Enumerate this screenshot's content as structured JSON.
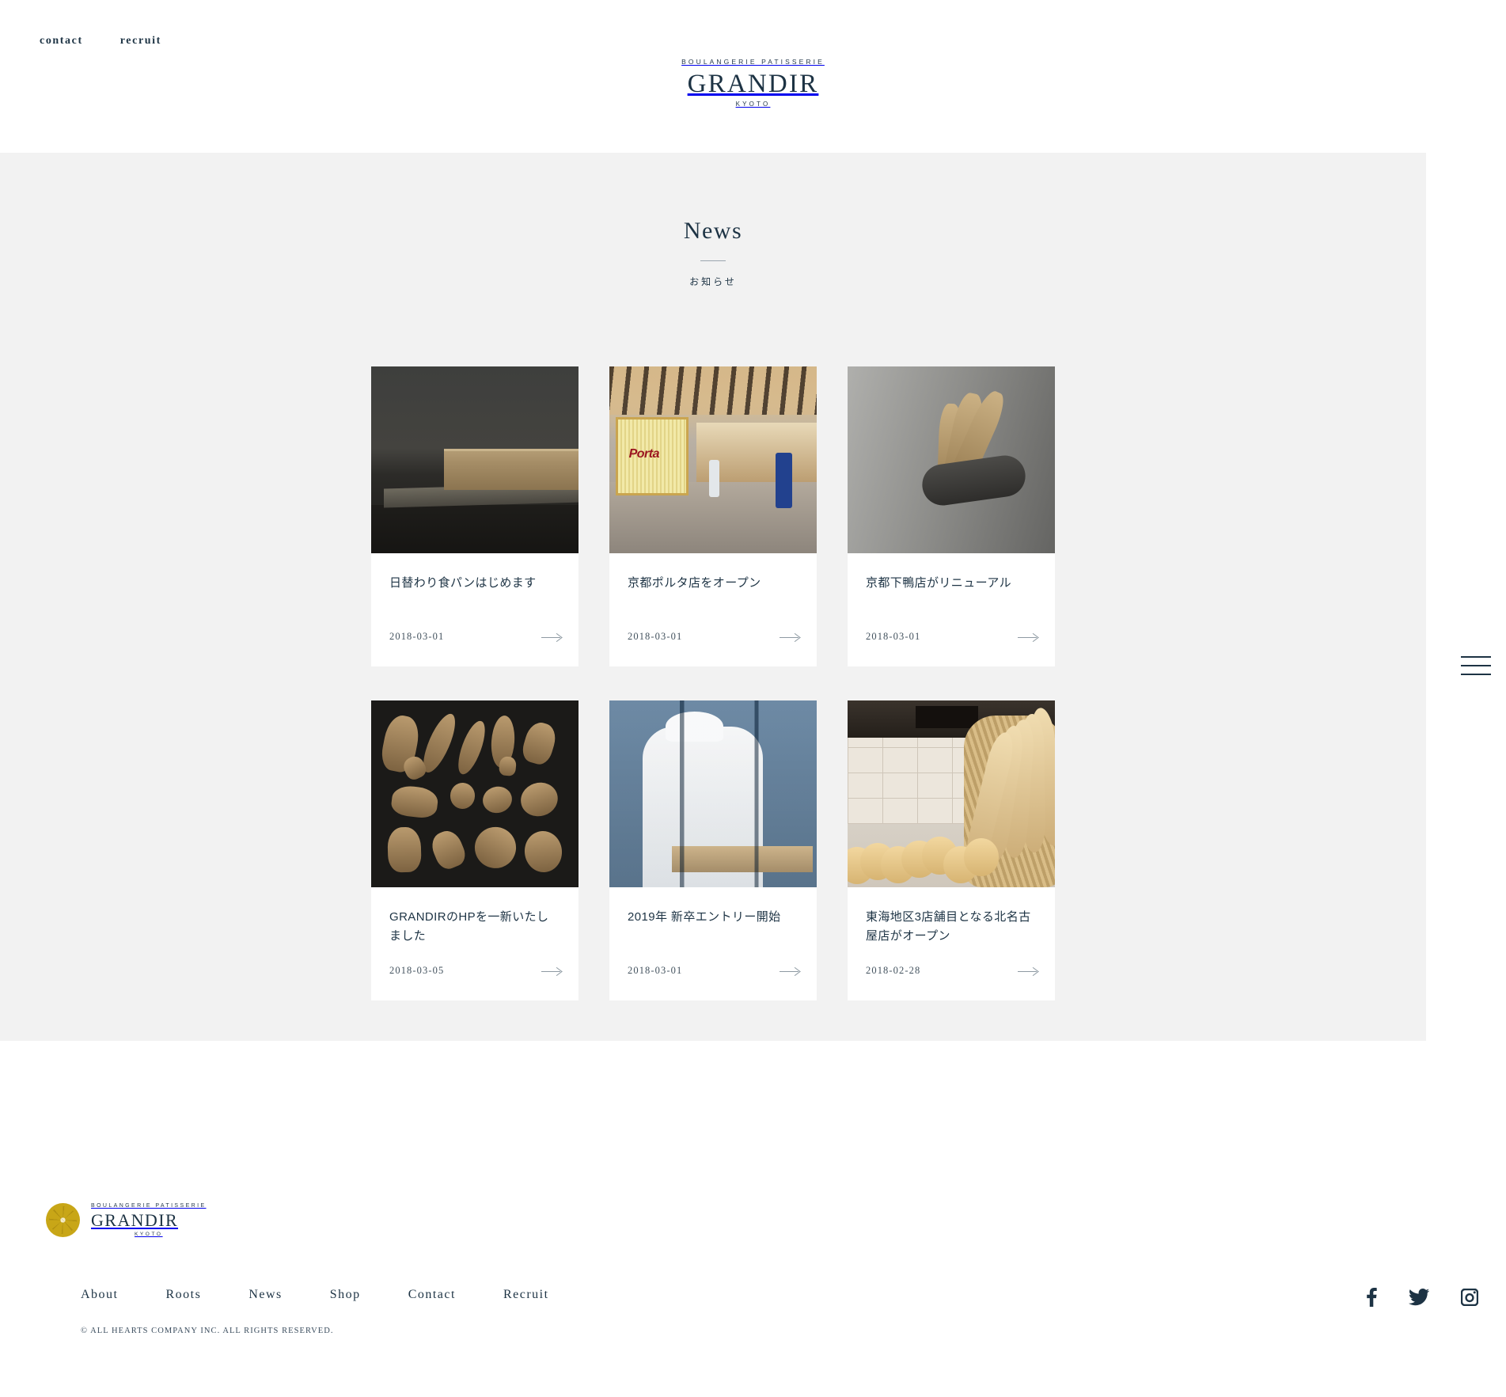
{
  "header": {
    "util_links": [
      {
        "label": "contact",
        "name": "contact"
      },
      {
        "label": "recruit",
        "name": "recruit"
      }
    ],
    "logo": {
      "superscript": "BOULANGERIE PATISSERIE",
      "name": "GRANDIR",
      "subscript": "KYOTO"
    },
    "menu_icon": "hamburger-menu-icon"
  },
  "news": {
    "title": "News",
    "subtitle": "お知らせ",
    "cards": [
      {
        "title": "日替わり食パンはじめます",
        "date": "2018-03-01",
        "image_alt": "dark-bread-loaf-photo",
        "arrow": "arrow-right-icon"
      },
      {
        "title": "京都ポルタ店をオープン",
        "date": "2018-03-01",
        "image_alt": "kyoto-porta-mall-storefront-photo",
        "arrow": "arrow-right-icon"
      },
      {
        "title": "京都下鴨店がリニューアル",
        "date": "2018-03-01",
        "image_alt": "baker-holding-baguettes-photo",
        "arrow": "arrow-right-icon"
      },
      {
        "title": "GRANDIRのHPを一新いたしました",
        "date": "2018-03-05",
        "image_alt": "bread-assortment-flatlay-photo",
        "arrow": "arrow-right-icon"
      },
      {
        "title": "2019年 新卒エントリー開始",
        "date": "2018-03-01",
        "image_alt": "baker-at-window-photo",
        "arrow": "arrow-right-icon"
      },
      {
        "title": "東海地区3店舗目となる北名古屋店がオープン",
        "date": "2018-02-28",
        "image_alt": "basket-of-baguettes-photo",
        "arrow": "arrow-right-icon"
      }
    ]
  },
  "scroll_top": {
    "icon": "arrow-up-icon",
    "label": ""
  },
  "footer": {
    "logo": {
      "superscript": "BOULANGERIE PATISSERIE",
      "name": "GRANDIR",
      "subscript": "KYOTO",
      "emblem": "gold-rosette-emblem"
    },
    "nav": [
      {
        "label": "About"
      },
      {
        "label": "Roots"
      },
      {
        "label": "News"
      },
      {
        "label": "Shop"
      },
      {
        "label": "Contact"
      },
      {
        "label": "Recruit"
      }
    ],
    "social": [
      {
        "name": "facebook-icon"
      },
      {
        "name": "twitter-icon"
      },
      {
        "name": "instagram-icon"
      }
    ],
    "copyright": "© ALL HEARTS COMPANY INC. ALL RIGHTS RESERVED."
  },
  "colors": {
    "ink": "#1d3344",
    "section_bg": "#f2f2f2",
    "card_bg": "#ffffff",
    "gold": "#c8a617",
    "muted": "#8e9aa3"
  }
}
